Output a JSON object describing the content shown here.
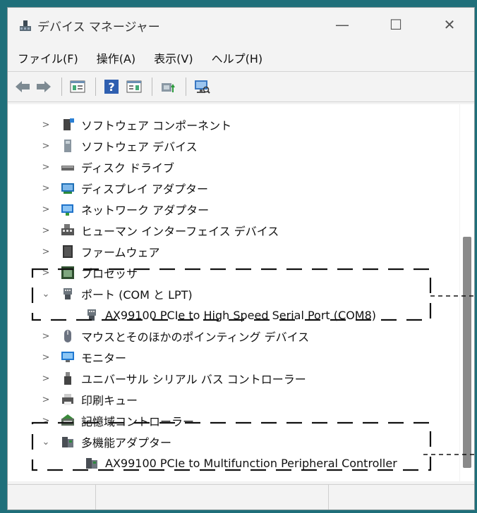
{
  "window": {
    "title": "デバイス マネージャー",
    "minimize": "—",
    "maximize": "☐",
    "close": "✕"
  },
  "menu": [
    "ファイル(F)",
    "操作(A)",
    "表示(V)",
    "ヘルプ(H)"
  ],
  "toolbar": [
    "back",
    "forward",
    "properties",
    "help",
    "view",
    "update-driver",
    "scan-hardware"
  ],
  "tree": [
    {
      "label": "ソフトウェア コンポーネント",
      "chevron": ">",
      "icon": "software-component-icon"
    },
    {
      "label": "ソフトウェア デバイス",
      "chevron": ">",
      "icon": "software-device-icon"
    },
    {
      "label": "ディスク ドライブ",
      "chevron": ">",
      "icon": "disk-drive-icon"
    },
    {
      "label": "ディスプレイ アダプター",
      "chevron": ">",
      "icon": "display-adapter-icon"
    },
    {
      "label": "ネットワーク アダプター",
      "chevron": ">",
      "icon": "network-adapter-icon"
    },
    {
      "label": "ヒューマン インターフェイス デバイス",
      "chevron": ">",
      "icon": "hid-icon"
    },
    {
      "label": "ファームウェア",
      "chevron": ">",
      "icon": "firmware-icon"
    },
    {
      "label": "プロセッサ",
      "chevron": ">",
      "icon": "processor-icon"
    },
    {
      "label": "ポート (COM と LPT)",
      "chevron": "⌄",
      "icon": "port-icon"
    },
    {
      "label": "AX99100 PCIe to High Speed Serial Port (COM8)",
      "chevron": "",
      "icon": "port-icon"
    },
    {
      "label": "マウスとそのほかのポインティング デバイス",
      "chevron": ">",
      "icon": "mouse-icon"
    },
    {
      "label": "モニター",
      "chevron": ">",
      "icon": "monitor-icon"
    },
    {
      "label": "ユニバーサル シリアル バス コントローラー",
      "chevron": ">",
      "icon": "usb-icon"
    },
    {
      "label": "印刷キュー",
      "chevron": ">",
      "icon": "printer-icon"
    },
    {
      "label": "記憶域コントローラー",
      "chevron": ">",
      "icon": "storage-controller-icon"
    },
    {
      "label": "多機能アダプター",
      "chevron": "⌄",
      "icon": "multifunction-adapter-icon"
    },
    {
      "label": "AX99100 PCIe to Multifunction Peripheral Controller",
      "chevron": "",
      "icon": "multifunction-adapter-icon"
    }
  ],
  "colors": {
    "background": "#1f6f7a",
    "window": "#f3f3f3",
    "tree": "#ffffff",
    "scroll_thumb": "#8a8a8a",
    "annotation": "#111111"
  }
}
